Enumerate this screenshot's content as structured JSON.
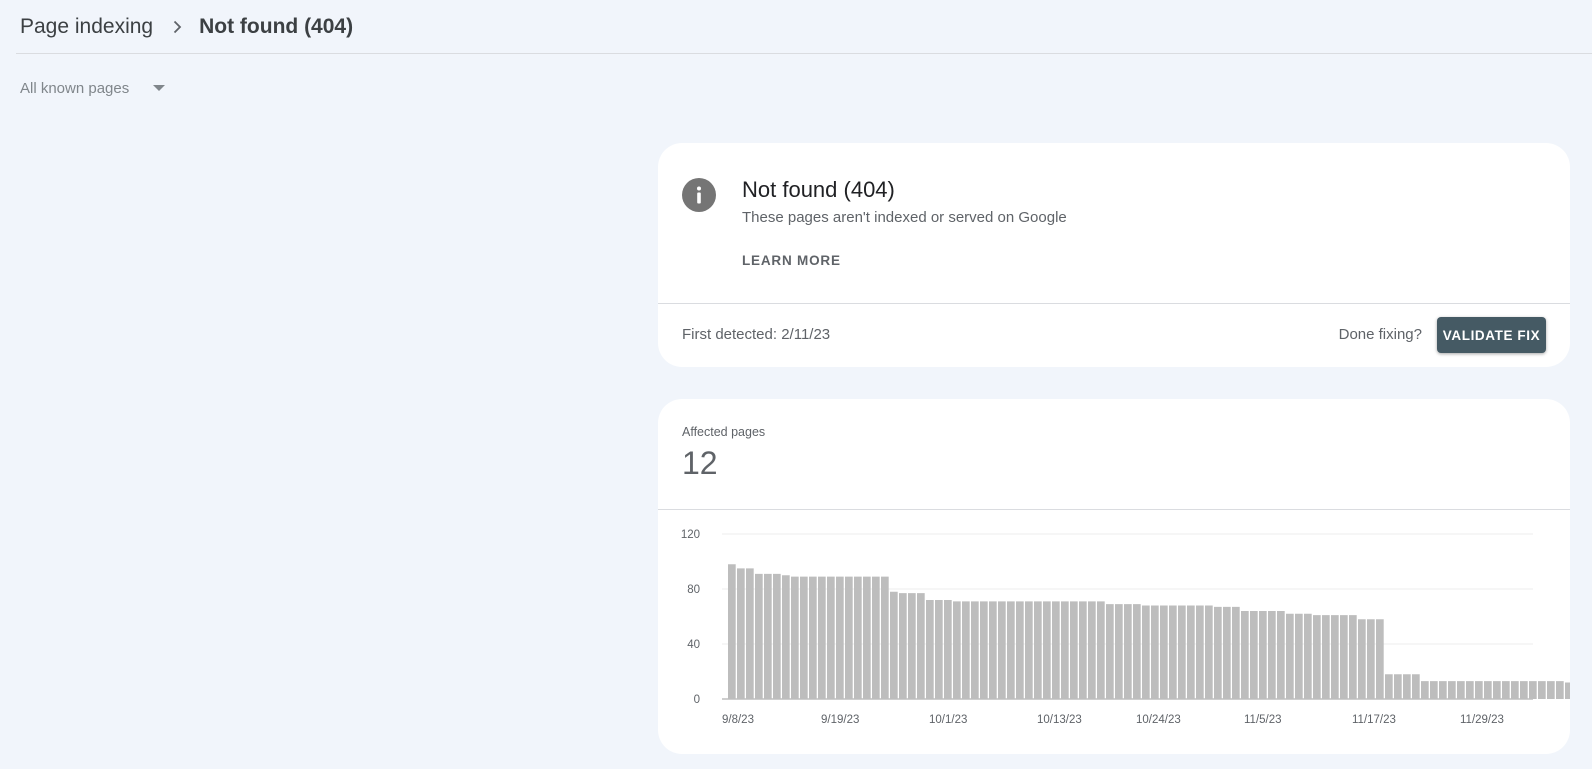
{
  "breadcrumb": {
    "root": "Page indexing",
    "current": "Not found (404)"
  },
  "filter": {
    "label": "All known pages"
  },
  "issue": {
    "title": "Not found (404)",
    "subtitle": "These pages aren't indexed or served on Google",
    "learn_more": "LEARN MORE",
    "first_detected": "First detected: 2/11/23",
    "done_fixing": "Done fixing?",
    "validate_label": "VALIDATE FIX"
  },
  "affected": {
    "label": "Affected pages",
    "value": "12"
  },
  "colors": {
    "bar": "#bdbdbd",
    "button": "#455a64",
    "background": "#f1f5fb"
  },
  "chart_data": {
    "type": "bar",
    "title": "",
    "xlabel": "",
    "ylabel": "",
    "ylim": [
      0,
      120
    ],
    "yticks": [
      0,
      40,
      80,
      120
    ],
    "grid": true,
    "x_tick_labels": [
      "9/8/23",
      "9/19/23",
      "10/1/23",
      "10/13/23",
      "10/24/23",
      "11/5/23",
      "11/17/23",
      "11/29/23"
    ],
    "categories": [
      "9/8/23",
      "9/9/23",
      "9/10/23",
      "9/11/23",
      "9/12/23",
      "9/13/23",
      "9/14/23",
      "9/15/23",
      "9/16/23",
      "9/17/23",
      "9/18/23",
      "9/19/23",
      "9/20/23",
      "9/21/23",
      "9/22/23",
      "9/23/23",
      "9/24/23",
      "9/25/23",
      "9/26/23",
      "9/27/23",
      "9/28/23",
      "9/29/23",
      "9/30/23",
      "10/1/23",
      "10/2/23",
      "10/3/23",
      "10/4/23",
      "10/5/23",
      "10/6/23",
      "10/7/23",
      "10/8/23",
      "10/9/23",
      "10/10/23",
      "10/11/23",
      "10/12/23",
      "10/13/23",
      "10/14/23",
      "10/15/23",
      "10/16/23",
      "10/17/23",
      "10/18/23",
      "10/19/23",
      "10/20/23",
      "10/21/23",
      "10/22/23",
      "10/23/23",
      "10/24/23",
      "10/25/23",
      "10/26/23",
      "10/27/23",
      "10/28/23",
      "10/29/23",
      "10/30/23",
      "10/31/23",
      "11/1/23",
      "11/2/23",
      "11/3/23",
      "11/4/23",
      "11/5/23",
      "11/6/23",
      "11/7/23",
      "11/8/23",
      "11/9/23",
      "11/10/23",
      "11/11/23",
      "11/12/23",
      "11/13/23",
      "11/14/23",
      "11/15/23",
      "11/16/23",
      "11/17/23",
      "11/18/23",
      "11/19/23",
      "11/20/23",
      "11/21/23",
      "11/22/23",
      "11/23/23",
      "11/24/23",
      "11/25/23",
      "11/26/23",
      "11/27/23",
      "11/28/23",
      "11/29/23",
      "11/30/23",
      "12/1/23",
      "12/2/23",
      "12/3/23",
      "12/4/23",
      "12/5/23",
      "12/6/23"
    ],
    "values": [
      98,
      95,
      95,
      91,
      91,
      91,
      90,
      89,
      89,
      89,
      89,
      89,
      89,
      89,
      89,
      89,
      89,
      89,
      78,
      77,
      77,
      77,
      72,
      72,
      72,
      71,
      71,
      71,
      71,
      71,
      71,
      71,
      71,
      71,
      71,
      71,
      71,
      71,
      71,
      71,
      71,
      71,
      69,
      69,
      69,
      69,
      68,
      68,
      68,
      68,
      68,
      68,
      68,
      68,
      67,
      67,
      67,
      64,
      64,
      64,
      64,
      64,
      62,
      62,
      62,
      61,
      61,
      61,
      61,
      61,
      58,
      58,
      58,
      18,
      18,
      18,
      18,
      13,
      13,
      13,
      13,
      13,
      13,
      13,
      13,
      13,
      13,
      13,
      13,
      13,
      13,
      13,
      13,
      12,
      12,
      12
    ]
  }
}
